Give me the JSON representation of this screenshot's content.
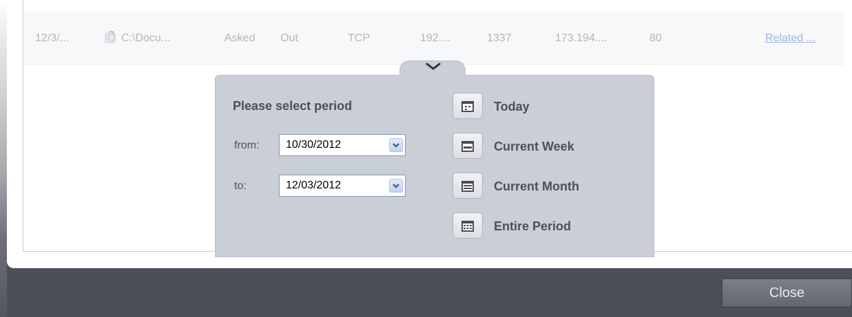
{
  "log_row": {
    "date": "12/3/...",
    "application": "C:\\Docu...",
    "action": "Asked",
    "direction": "Out",
    "protocol": "TCP",
    "source_ip": "192....",
    "source_port": "1337",
    "destination_ip": "173.194....",
    "destination_port": "80",
    "related_link": "Related ..."
  },
  "period_popup": {
    "title": "Please select period",
    "from_label": "from:",
    "from_value": "10/30/2012",
    "to_label": "to:",
    "to_value": "12/03/2012",
    "quick_options": [
      "Today",
      "Current Week",
      "Current Month",
      "Entire Period"
    ]
  },
  "footer": {
    "close_label": "Close"
  },
  "colors": {
    "popup_bg": "#c9ced7",
    "footer_bg": "#4b4f58",
    "link": "#9cb6e4"
  }
}
